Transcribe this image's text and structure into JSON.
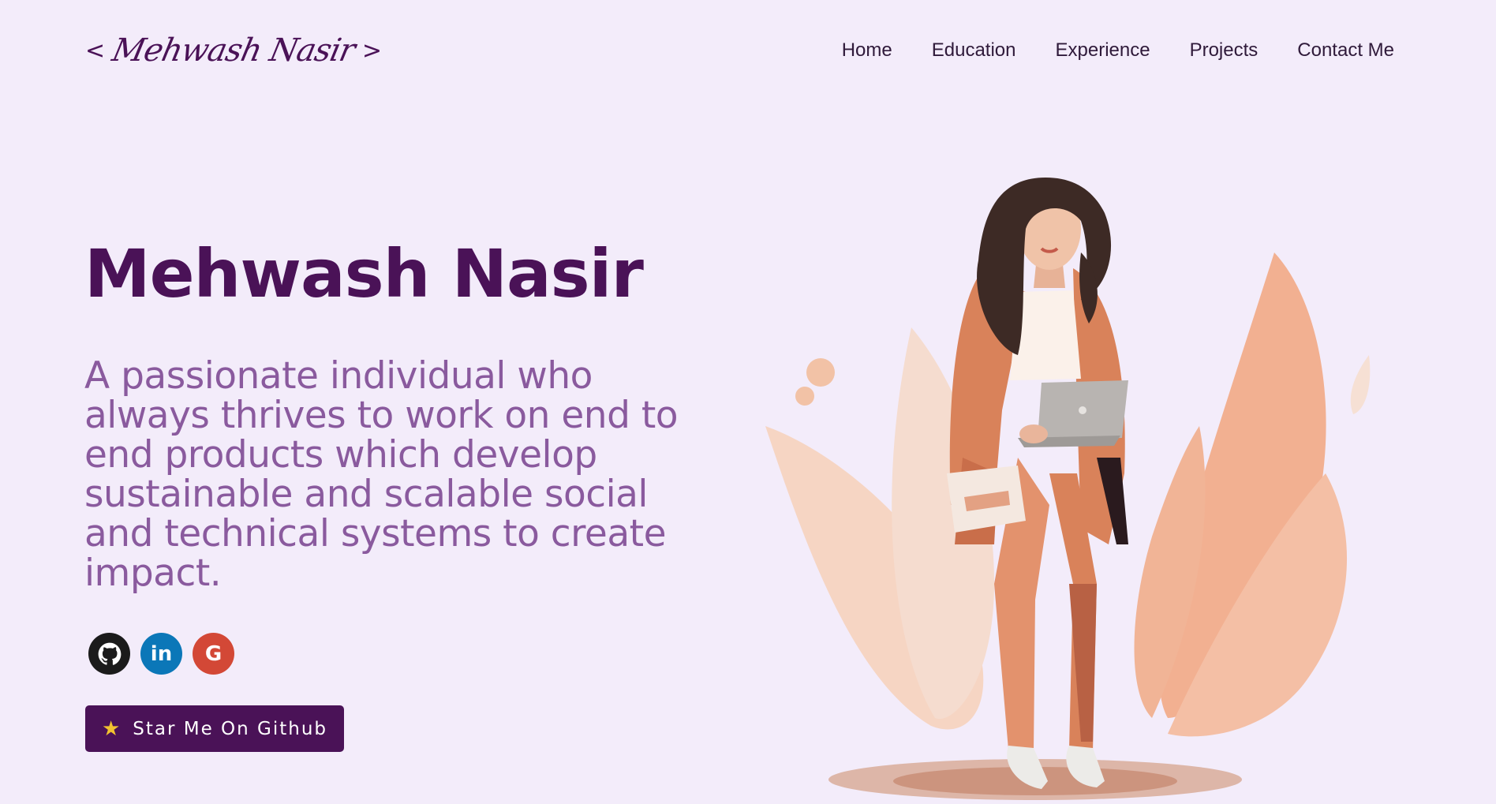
{
  "header": {
    "logo": {
      "open_bracket": "<",
      "signature": "Mehwash Nasir",
      "close_bracket": ">"
    },
    "nav": [
      {
        "label": "Home"
      },
      {
        "label": "Education"
      },
      {
        "label": "Experience"
      },
      {
        "label": "Projects"
      },
      {
        "label": "Contact Me"
      }
    ]
  },
  "hero": {
    "name": "Mehwash Nasir",
    "description": "A passionate individual who always thrives to work on end to end products which develop sustainable and scalable social and technical systems to create impact.",
    "socials": [
      {
        "icon": "github-icon",
        "glyph": ""
      },
      {
        "icon": "linkedin-icon",
        "glyph": "in"
      },
      {
        "icon": "google-icon",
        "glyph": "G"
      }
    ],
    "button": {
      "icon": "star-icon",
      "label": "Star Me On Github"
    }
  },
  "colors": {
    "background": "#f3ecfa",
    "primary": "#4a1257",
    "description_text": "#8a5a9e",
    "github": "#1b1b1b",
    "linkedin": "#0b77b8",
    "google": "#d34836",
    "star": "#f2c230",
    "illustration_suit": "#d9825a",
    "illustration_leaves": "#f3b496"
  }
}
